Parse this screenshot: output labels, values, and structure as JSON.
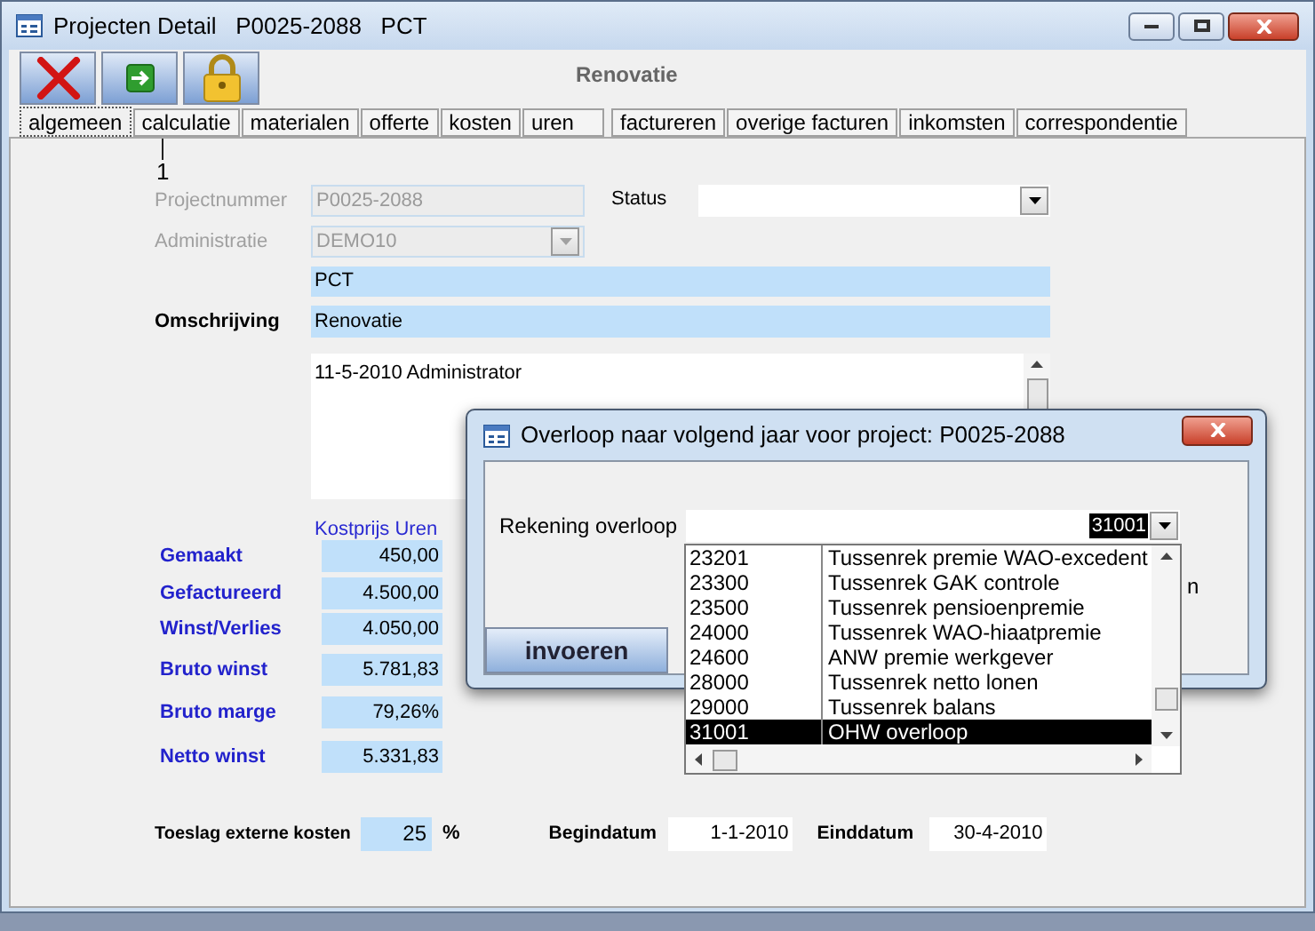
{
  "window": {
    "title": "Projecten Detail   P0025-2088   PCT",
    "heading": "Renovatie"
  },
  "toolbar": [
    {
      "kind": "delete"
    },
    {
      "kind": "next"
    },
    {
      "kind": "lock"
    }
  ],
  "callout": "1",
  "tabs": [
    {
      "label": "algemeen",
      "selected": true
    },
    {
      "label": "calculatie",
      "selected": false
    },
    {
      "label": "materialen",
      "selected": false
    },
    {
      "label": "offerte",
      "selected": false
    },
    {
      "label": "kosten",
      "selected": false
    },
    {
      "label": "uren",
      "selected": false
    },
    {
      "label": "factureren",
      "selected": false
    },
    {
      "label": "overige facturen",
      "selected": false
    },
    {
      "label": "inkomsten",
      "selected": false
    },
    {
      "label": "correspondentie",
      "selected": false
    }
  ],
  "form": {
    "projectnummer": {
      "label": "Projectnummer",
      "value": "P0025-2088",
      "disabled": true
    },
    "status": {
      "label": "Status"
    },
    "administratie": {
      "label": "Administratie",
      "value": "DEMO10",
      "disabled": true
    },
    "klant": {
      "value": "PCT"
    },
    "omschrijving": {
      "label": "Omschrijving",
      "value": "Renovatie"
    },
    "memo": {
      "value": "11-5-2010 Administrator"
    }
  },
  "costs": {
    "header": "Kostprijs Uren",
    "rows": [
      {
        "label": "Gemaakt",
        "value": "450,00"
      },
      {
        "label": "Gefactureerd",
        "value": "4.500,00"
      },
      {
        "label": "Winst/Verlies",
        "value": "4.050,00"
      },
      {
        "label": "Bruto winst",
        "value": "5.781,83"
      },
      {
        "label": "Bruto marge",
        "value": "79,26%"
      },
      {
        "label": "Netto winst",
        "value": "5.331,83"
      }
    ]
  },
  "footer": {
    "toeslag_label": "Toeslag externe kosten",
    "toeslag_value": "25",
    "toeslag_unit": "%",
    "begindatum_label": "Begindatum",
    "begindatum": "1-1-2010",
    "einddatum_label": "Einddatum",
    "einddatum": "30-4-2010"
  },
  "dialog": {
    "title": "Overloop naar volgend jaar voor project: P0025-2088",
    "field_label": "Rekening overloop",
    "field_value": "31001",
    "hidden_label_fragment": "n",
    "button": "invoeren",
    "list": [
      {
        "code": "23201",
        "name": "Tussenrek premie WAO-excedent",
        "selected": false
      },
      {
        "code": "23300",
        "name": "Tussenrek GAK controle",
        "selected": false
      },
      {
        "code": "23500",
        "name": "Tussenrek pensioenpremie",
        "selected": false
      },
      {
        "code": "24000",
        "name": "Tussenrek WAO-hiaatpremie",
        "selected": false
      },
      {
        "code": "24600",
        "name": "ANW premie werkgever",
        "selected": false
      },
      {
        "code": "28000",
        "name": "Tussenrek netto lonen",
        "selected": false
      },
      {
        "code": "29000",
        "name": "Tussenrek balans",
        "selected": false
      },
      {
        "code": "31001",
        "name": "OHW overloop",
        "selected": true
      }
    ]
  }
}
